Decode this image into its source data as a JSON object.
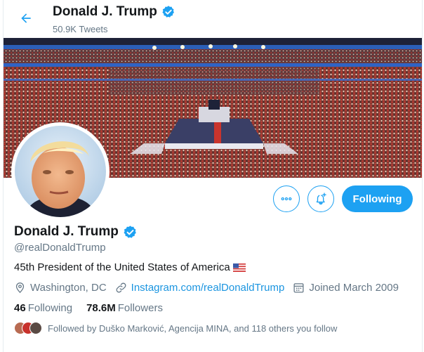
{
  "header": {
    "back_icon": "arrow-left-icon",
    "name": "Donald J. Trump",
    "tweet_count": "50.9K Tweets"
  },
  "profile": {
    "display_name": "Donald J. Trump",
    "verified_icon": "verified-badge-icon",
    "handle": "@realDonaldTrump",
    "bio": "45th President of the United States of America",
    "bio_emoji": "us-flag-emoji",
    "location": "Washington, DC",
    "location_icon": "location-pin-icon",
    "website": "Instagram.com/realDonaldTrump",
    "website_icon": "link-icon",
    "joined": "Joined March 2009",
    "joined_icon": "calendar-icon"
  },
  "actions": {
    "more_icon": "more-options-icon",
    "notify_icon": "add-notification-bell-icon",
    "following_label": "Following"
  },
  "stats": {
    "following_count": "46",
    "following_label": "Following",
    "followers_count": "78.6M",
    "followers_label": "Followers"
  },
  "followed_by": {
    "text": "Followed by Duško Marković, Agencija MINA, and 118 others you follow"
  },
  "colors": {
    "accent": "#1da1f2",
    "link": "#1b95e0",
    "muted": "#657786",
    "text": "#14171a"
  }
}
